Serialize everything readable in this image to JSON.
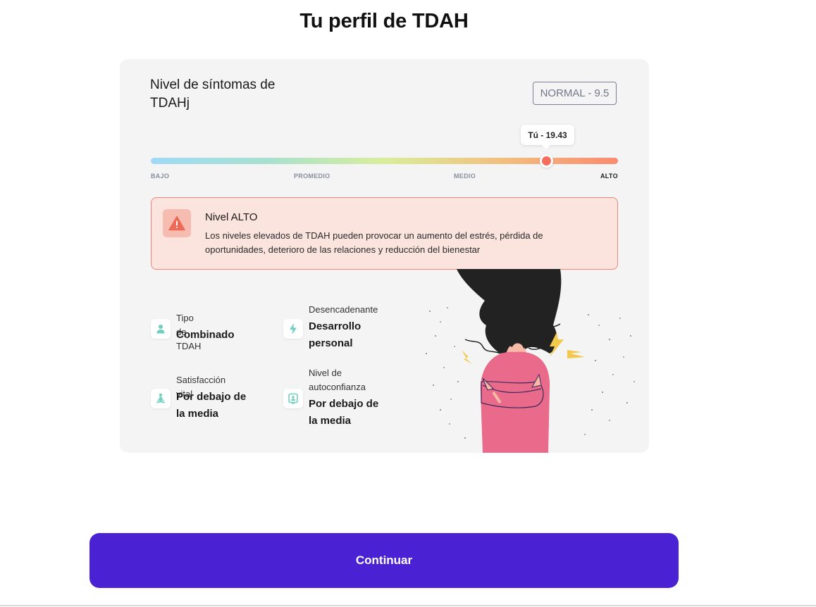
{
  "page_title": "Tu perfil de TDAH",
  "card": {
    "heading": "Nivel de síntomas de TDAHj",
    "normal_badge": "NORMAL - 9.5",
    "you_tooltip": "Tú - 19.43",
    "scale_labels": [
      "BAJO",
      "PROMEDIO",
      "MEDIO",
      "ALTO"
    ],
    "active_level": "ALTO",
    "user_score": 19.43,
    "normal_score": 9.5
  },
  "alert": {
    "title": "Nivel ALTO",
    "text": "Los niveles elevados de TDAH pueden provocar un aumento del estrés, pérdida de oportunidades, deterioro de las relaciones y reducción del bienestar",
    "icon": "warning-triangle-icon"
  },
  "stats": [
    {
      "label": "Tipo de TDAH",
      "value": "Combinado",
      "icon": "person-icon"
    },
    {
      "label": "Desencadenante",
      "value": "Desarrollo personal",
      "icon": "lightning-icon"
    },
    {
      "label": "Satisfacción vital",
      "value": "Por debajo de la media",
      "icon": "meditation-icon"
    },
    {
      "label": "Nivel de autoconfianza",
      "value": "Por debajo de la media",
      "icon": "mirror-icon"
    }
  ],
  "continue_button": "Continuar",
  "colors": {
    "accent": "#4a22d3",
    "alert_bg": "#fbe3de",
    "alert_border": "#f1857a",
    "marker": "#f66c5f",
    "icon_teal": "#6fd0c0"
  }
}
